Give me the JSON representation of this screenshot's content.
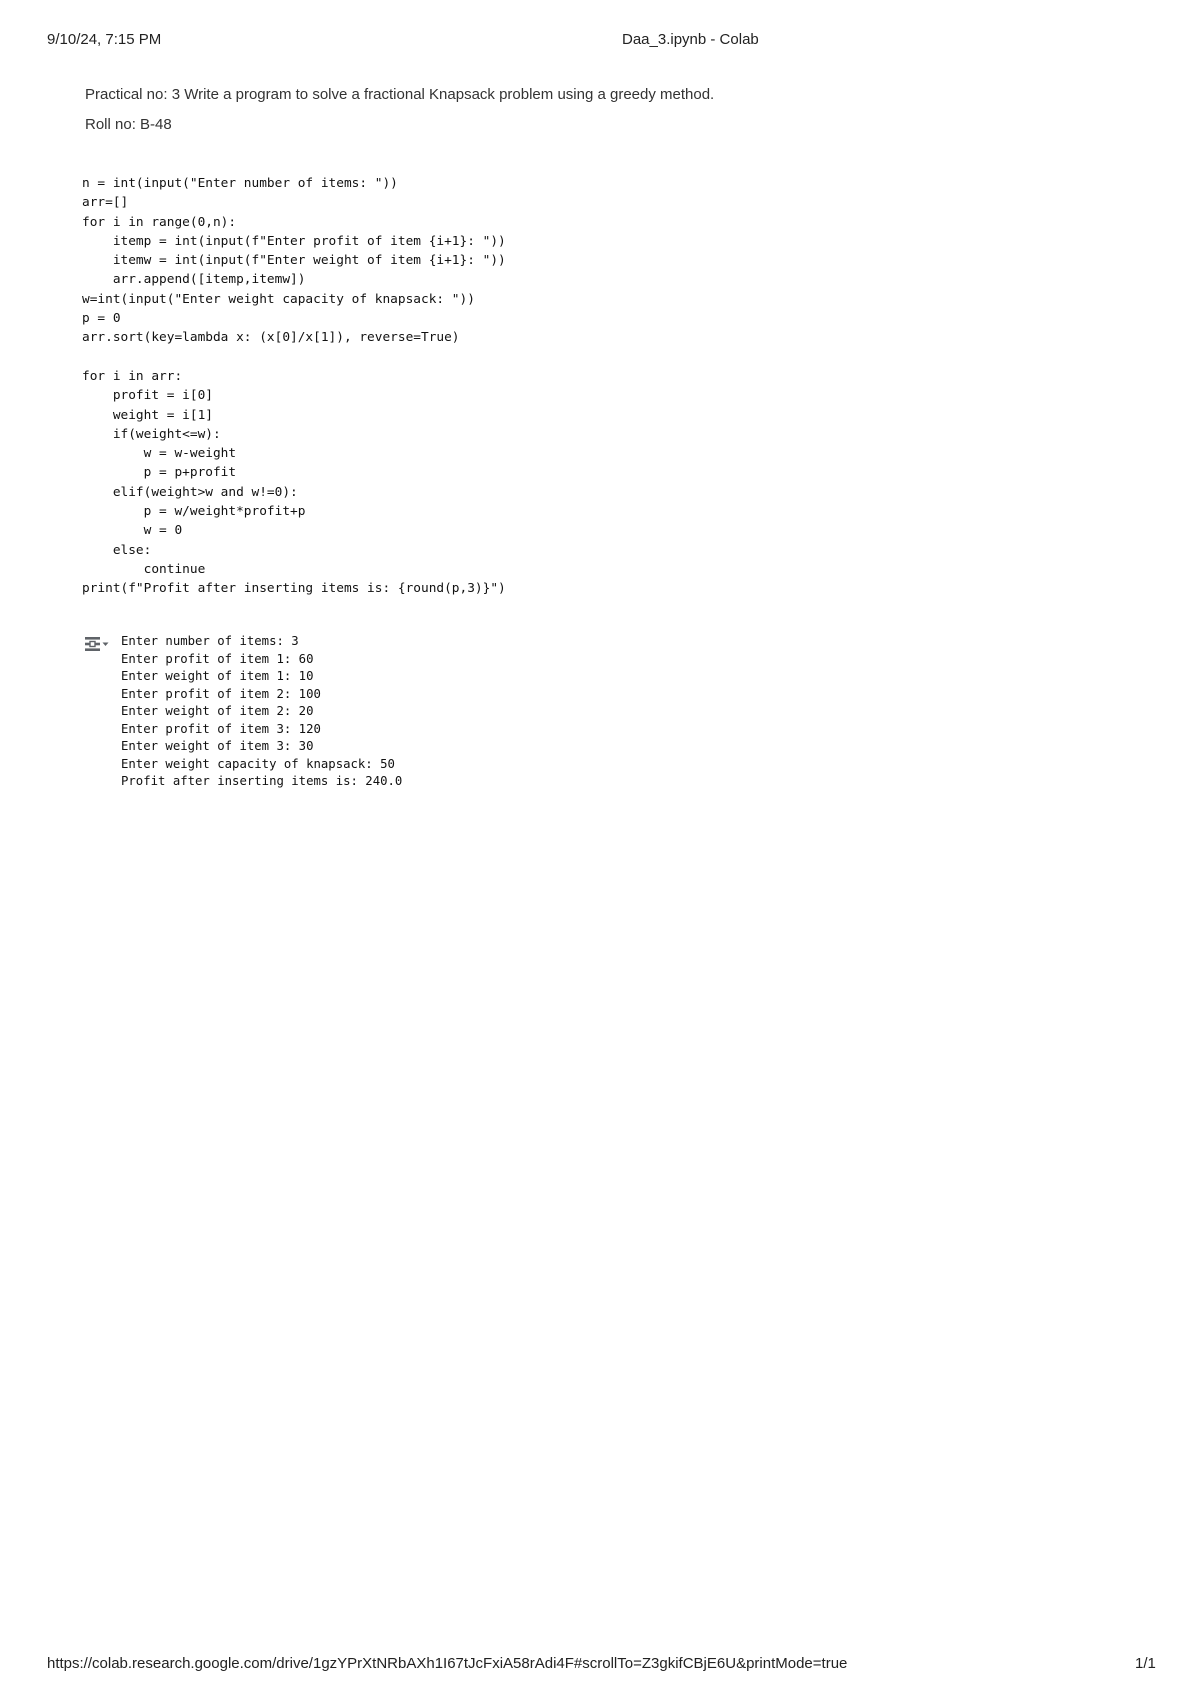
{
  "print_header": {
    "datetime": "9/10/24, 7:15 PM",
    "title": "Daa_3.ipynb - Colab"
  },
  "text_cell": {
    "practical": "Practical no: 3 Write a program to solve a fractional Knapsack problem using a greedy method.",
    "roll": "Roll no: B-48"
  },
  "code_cell": {
    "source": "n = int(input(\"Enter number of items: \"))\narr=[]\nfor i in range(0,n):\n    itemp = int(input(f\"Enter profit of item {i+1}: \"))\n    itemw = int(input(f\"Enter weight of item {i+1}: \"))\n    arr.append([itemp,itemw])\nw=int(input(\"Enter weight capacity of knapsack: \"))\np = 0\narr.sort(key=lambda x: (x[0]/x[1]), reverse=True)\n\nfor i in arr:\n    profit = i[0]\n    weight = i[1]\n    if(weight<=w):\n        w = w-weight\n        p = p+profit\n    elif(weight>w and w!=0):\n        p = w/weight*profit+p\n        w = 0\n    else:\n        continue\nprint(f\"Profit after inserting items is: {round(p,3)}\")"
  },
  "output": {
    "icon": "output-toggle-icon",
    "text": "Enter number of items: 3\nEnter profit of item 1: 60\nEnter weight of item 1: 10\nEnter profit of item 2: 100\nEnter weight of item 2: 20\nEnter profit of item 3: 120\nEnter weight of item 3: 30\nEnter weight capacity of knapsack: 50\nProfit after inserting items is: 240.0"
  },
  "print_footer": {
    "url": "https://colab.research.google.com/drive/1gzYPrXtNRbAXh1I67tJcFxiA58rAdi4F#scrollTo=Z3gkifCBjE6U&printMode=true",
    "page": "1/1"
  }
}
